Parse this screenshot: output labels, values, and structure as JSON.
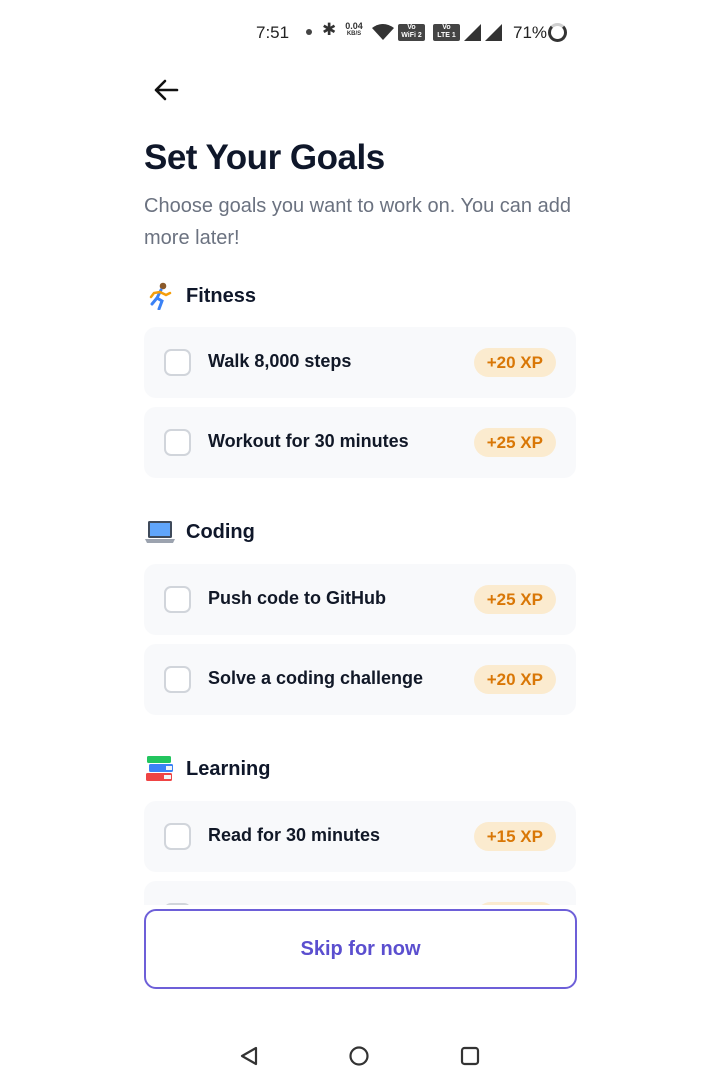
{
  "status_bar": {
    "time": "7:51",
    "net_speed_value": "0.04",
    "net_speed_unit": "KB/S",
    "sim1_label_top": "Vo",
    "sim1_label_bottom": "WiFi 2",
    "sim2_label_top": "Vo",
    "sim2_label_bottom": "LTE 1",
    "battery": "71%"
  },
  "header": {
    "back_icon": "arrow-left-icon",
    "title": "Set Your Goals",
    "subtitle": "Choose goals you want to work on. You can add more later!"
  },
  "sections": [
    {
      "emoji": "🏃",
      "label": "Fitness",
      "goals": [
        {
          "label": "Walk 8,000 steps",
          "xp": "+20 XP"
        },
        {
          "label": "Workout for 30 minutes",
          "xp": "+25 XP"
        }
      ]
    },
    {
      "emoji": "💻",
      "label": "Coding",
      "goals": [
        {
          "label": "Push code to GitHub",
          "xp": "+25 XP"
        },
        {
          "label": "Solve a coding challenge",
          "xp": "+20 XP"
        }
      ]
    },
    {
      "emoji": "📚",
      "label": "Learning",
      "goals": [
        {
          "label": "Read for 30 minutes",
          "xp": "+15 XP"
        }
      ]
    }
  ],
  "skip_button": {
    "label": "Skip for now"
  },
  "colors": {
    "accent": "#6d5fd8",
    "xp_badge_bg": "#fbebcf",
    "xp_badge_text": "#d97706",
    "card_bg": "#f8f9fb"
  },
  "nav_bar": {
    "back_icon": "triangle-back-icon",
    "home_icon": "circle-home-icon",
    "recents_icon": "square-recents-icon"
  }
}
